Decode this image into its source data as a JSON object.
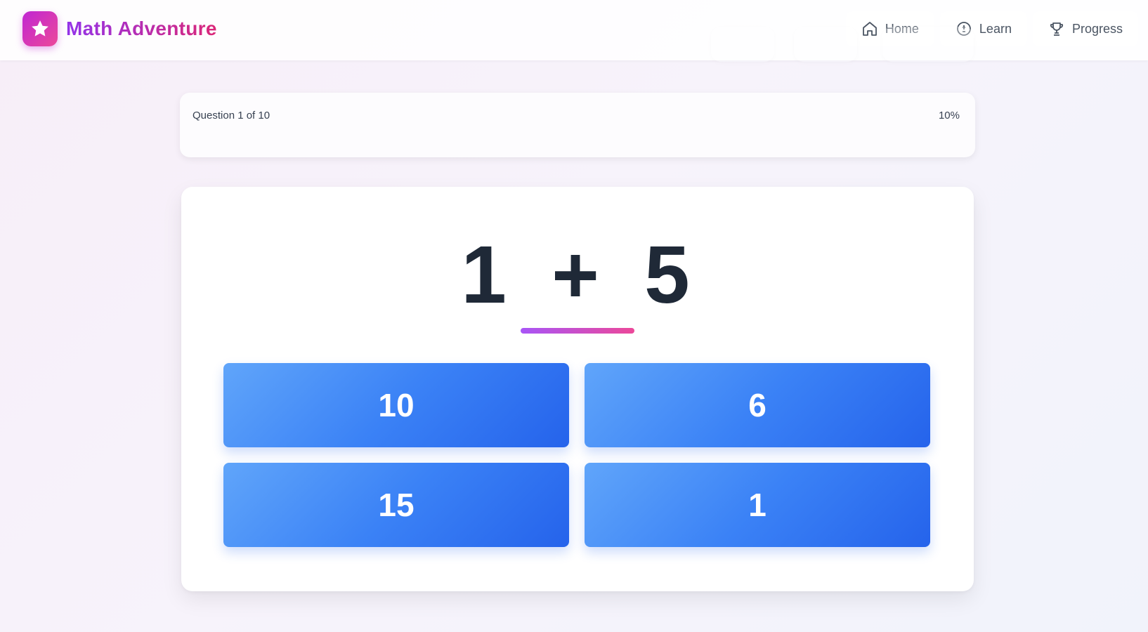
{
  "app": {
    "title": "Math Adventure",
    "logo_icon": "star-icon"
  },
  "nav": {
    "items": [
      {
        "label": "Home",
        "icon": "home-icon"
      },
      {
        "label": "Learn",
        "icon": "lightbulb-icon"
      },
      {
        "label": "Progress",
        "icon": "trophy-icon"
      }
    ]
  },
  "progress": {
    "label": "Question 1 of 10",
    "percent_text": "10%",
    "current": 1,
    "total": 10
  },
  "question": {
    "text": "1 + 5"
  },
  "answers": [
    "10",
    "6",
    "15",
    "1"
  ],
  "colors": {
    "brand_gradient_start": "#9333ea",
    "brand_gradient_end": "#db2777",
    "answer_button": "#3b82f6",
    "question_text": "#1f2937"
  }
}
